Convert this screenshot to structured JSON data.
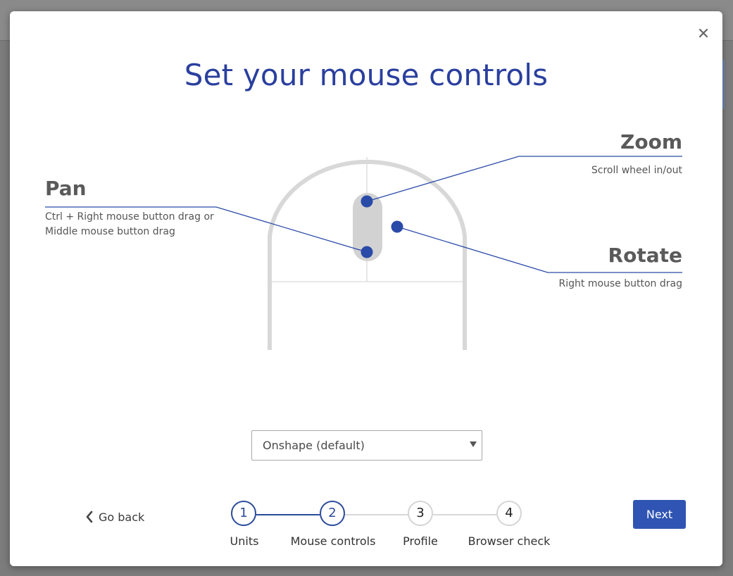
{
  "modal": {
    "title": "Set your mouse controls",
    "close_icon": "close-icon"
  },
  "controls": {
    "pan": {
      "heading": "Pan",
      "description_line1": "Ctrl + Right mouse button drag or",
      "description_line2": "Middle mouse button drag"
    },
    "zoom": {
      "heading": "Zoom",
      "description": "Scroll wheel in/out"
    },
    "rotate": {
      "heading": "Rotate",
      "description": "Right mouse button drag"
    }
  },
  "mouse_preset": {
    "selected": "Onshape (default)"
  },
  "navigation": {
    "back_label": "Go back",
    "next_label": "Next"
  },
  "steps": [
    {
      "number": "1",
      "label": "Units",
      "state": "completed"
    },
    {
      "number": "2",
      "label": "Mouse controls",
      "state": "current"
    },
    {
      "number": "3",
      "label": "Profile",
      "state": "upcoming"
    },
    {
      "number": "4",
      "label": "Browser check",
      "state": "upcoming"
    }
  ],
  "colors": {
    "accent": "#2a3f9e",
    "button": "#2f54b3",
    "pointer_dot": "#2a4aa8",
    "mouse_outline": "#d8d8d8"
  }
}
